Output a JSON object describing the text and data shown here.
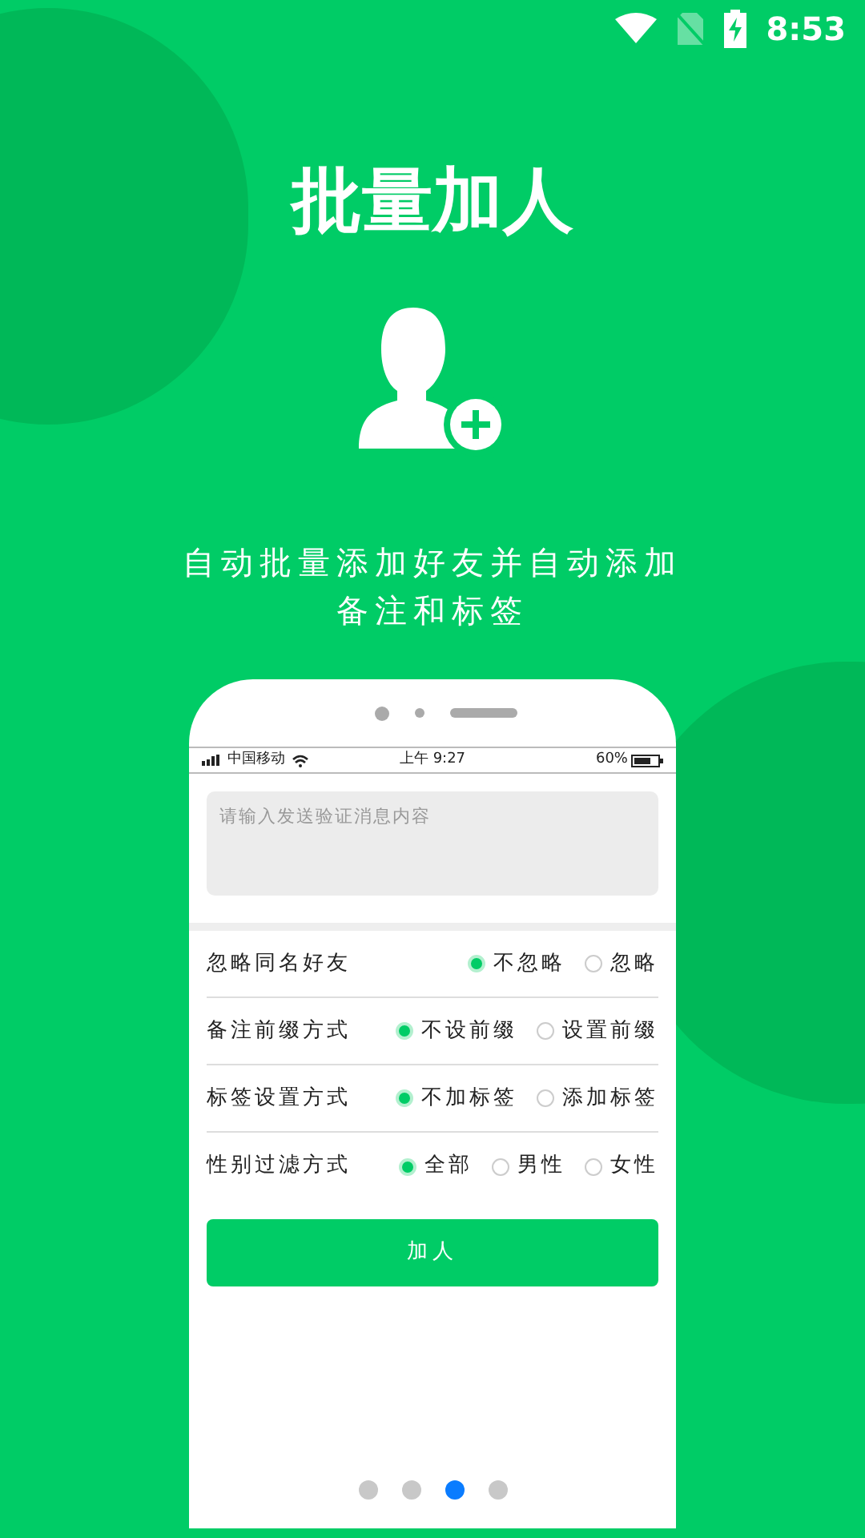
{
  "status_bar": {
    "time": "8:53"
  },
  "title": "批量加人",
  "subtitle": [
    "自动批量添加好友并自动添加",
    "备注和标签"
  ],
  "phone": {
    "status_bar": {
      "carrier": "中国移动",
      "time": "上午 9:27",
      "battery": "60%"
    },
    "message_field": {
      "placeholder": "请输入发送验证消息内容"
    },
    "settings": [
      {
        "label": "忽略同名好友",
        "options": [
          {
            "label": "不忽略",
            "selected": true
          },
          {
            "label": "忽略",
            "selected": false
          }
        ]
      },
      {
        "label": "备注前缀方式",
        "options": [
          {
            "label": "不设前缀",
            "selected": true
          },
          {
            "label": "设置前缀",
            "selected": false
          }
        ]
      },
      {
        "label": "标签设置方式",
        "options": [
          {
            "label": "不加标签",
            "selected": true
          },
          {
            "label": "添加标签",
            "selected": false
          }
        ]
      },
      {
        "label": "性别过滤方式",
        "options": [
          {
            "label": "全部",
            "selected": true
          },
          {
            "label": "男性",
            "selected": false
          },
          {
            "label": "女性",
            "selected": false
          }
        ]
      }
    ],
    "button": "加人"
  },
  "pager": [
    {
      "selected": false
    },
    {
      "selected": false
    },
    {
      "selected": true
    },
    {
      "selected": false
    }
  ]
}
